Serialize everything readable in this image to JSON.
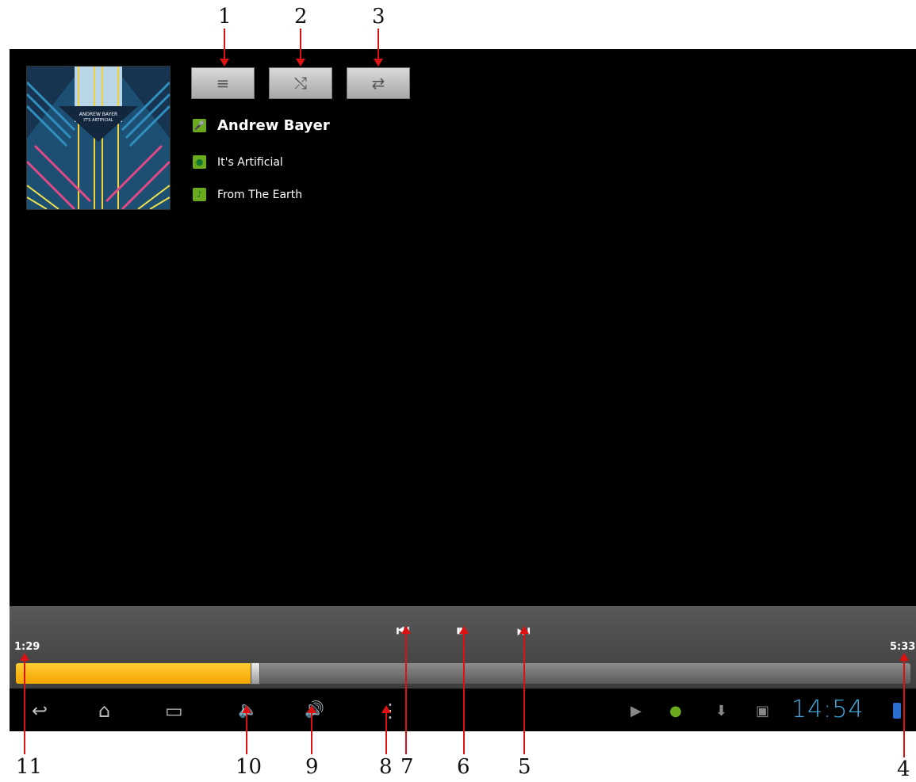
{
  "callouts": [
    "1",
    "2",
    "3",
    "4",
    "5",
    "6",
    "7",
    "8",
    "9",
    "10",
    "11"
  ],
  "player": {
    "artist": "Andrew Bayer",
    "album": "It's Artificial",
    "track": "From The Earth",
    "album_art_text": "ANDREW BAYER\nIT'S ARTIFICIAL"
  },
  "buttons": {
    "playlist_icon": "≡",
    "shuffle_icon": "⤭",
    "repeat_icon": "⇄"
  },
  "transport": {
    "elapsed": "1:29",
    "total": "5:33",
    "progress_fraction": 0.268,
    "prev_icon": "⏮",
    "pause_icon": "⏸",
    "next_icon": "⏭"
  },
  "navbar": {
    "back_icon": "↩",
    "home_icon": "⌂",
    "recents_icon": "▭",
    "vol_down_icon": "🔈",
    "vol_up_icon": "🔊",
    "menu_icon": "⋮"
  },
  "status": {
    "clock": "14:54"
  },
  "colors": {
    "accent": "#f2a500",
    "clock": "#3fa9e0",
    "meta_icon": "#6aaa1c"
  }
}
